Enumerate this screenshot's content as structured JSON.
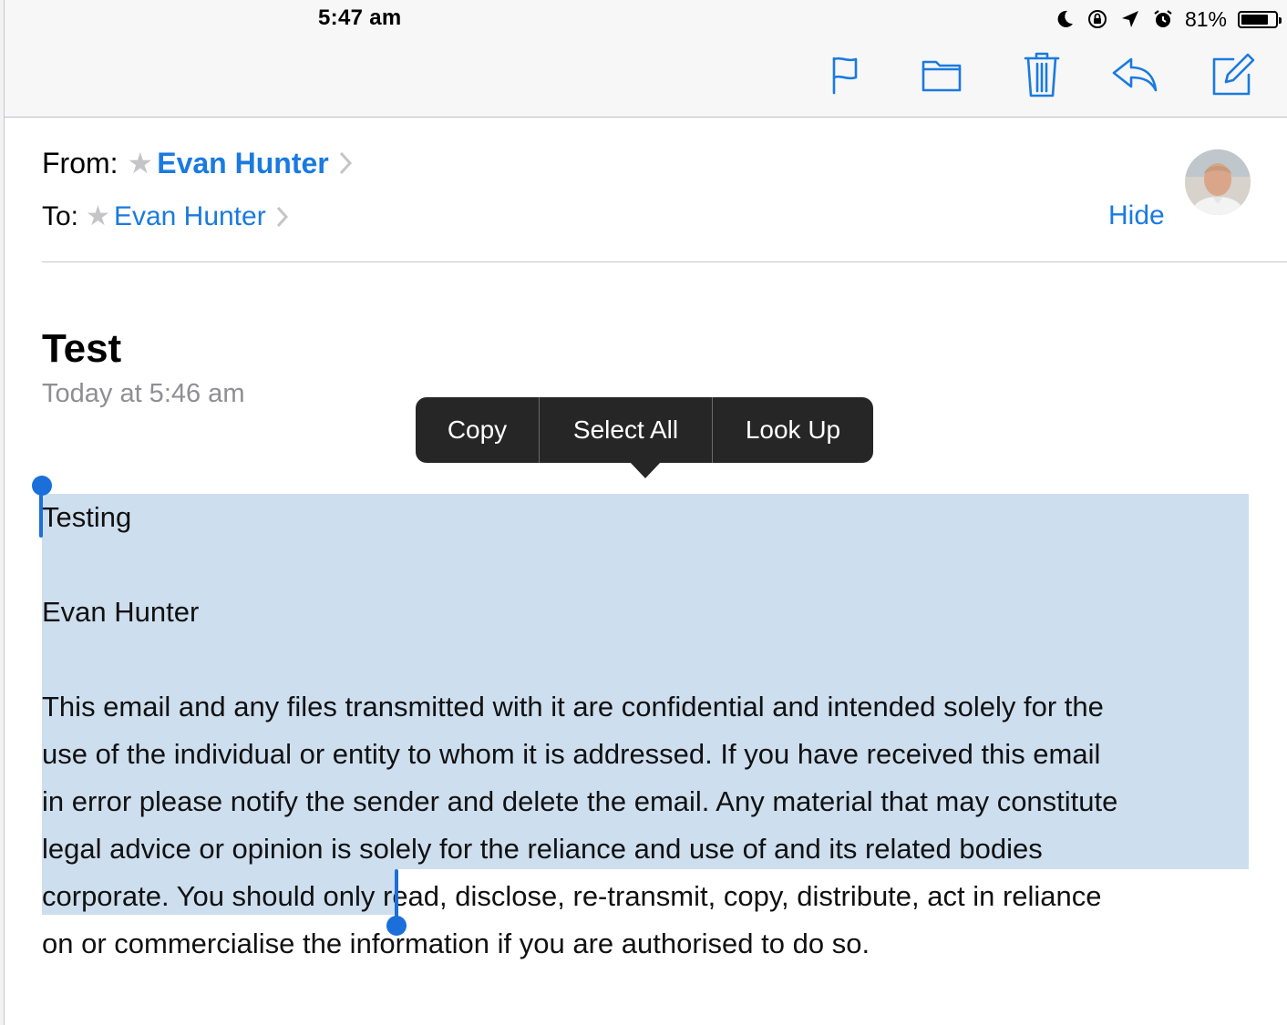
{
  "status_bar": {
    "time": "5:47 am",
    "battery": "81%",
    "battery_level": 0.81
  },
  "toolbar": {
    "flag_icon": "flag-icon",
    "move_icon": "folder-icon",
    "trash_icon": "trash-icon",
    "reply_icon": "reply-icon",
    "compose_icon": "compose-icon",
    "accent": "#1a7ae0"
  },
  "header": {
    "from_label": "From:",
    "from_name": "Evan Hunter",
    "to_label": "To:",
    "to_name": "Evan Hunter",
    "hide_label": "Hide"
  },
  "message": {
    "subject": "Test",
    "date": "Today at 5:46 am",
    "body_lines": [
      "Testing",
      "Evan Hunter",
      "This email and any files transmitted with it are confidential and intended solely for the",
      "use of the individual or entity to whom it is addressed. If you have received this email",
      "in error please notify the sender and delete the email. Any material that may constitute",
      "legal advice or opinion is solely for the reliance and use of and its related bodies",
      "corporate. You should only read, disclose, re-transmit, copy, distribute, act in reliance",
      "on or commercialise the information if you are authorised to do so."
    ]
  },
  "selection_menu": {
    "copy": "Copy",
    "select_all": "Select All",
    "look_up": "Look Up",
    "highlight_color": "#cddeee"
  }
}
